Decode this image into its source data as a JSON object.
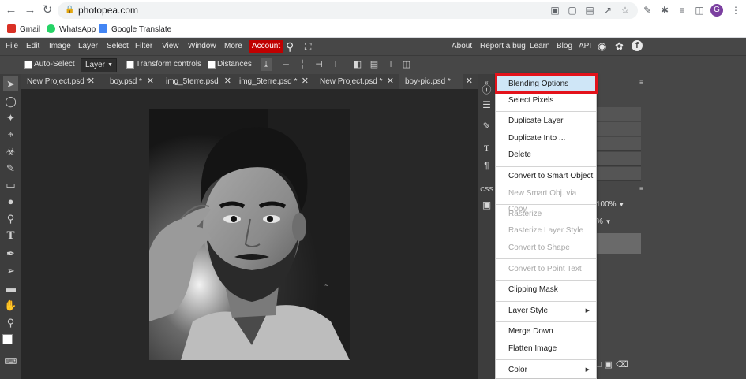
{
  "browser": {
    "url": "photopea.com",
    "profile_initial": "G",
    "bookmarks": [
      {
        "label": "Gmail",
        "color": "#d93025"
      },
      {
        "label": "WhatsApp",
        "color": "#25d366"
      },
      {
        "label": "Google Translate",
        "color": "#4285f4"
      }
    ]
  },
  "menu": {
    "left": [
      "File",
      "Edit",
      "Image",
      "Layer",
      "Select",
      "Filter",
      "View",
      "Window",
      "More"
    ],
    "account": "Account",
    "right": [
      "About",
      "Report a bug",
      "Learn",
      "Blog",
      "API"
    ]
  },
  "options": {
    "auto_select": "Auto-Select",
    "layer_select": "Layer",
    "transform_controls": "Transform controls",
    "distances": "Distances"
  },
  "doc_tabs": [
    "New Project.psd *",
    "boy.psd *",
    "img_5terre.psd",
    "img_5terre.psd *",
    "New Project.psd *",
    "boy-pic.psd *"
  ],
  "panel": {
    "opacity": "100%"
  },
  "context_menu": {
    "items": [
      {
        "label": "Blending Options",
        "disabled": false,
        "submenu": false
      },
      {
        "label": "Select Pixels",
        "disabled": false,
        "submenu": false
      },
      {
        "label": "Duplicate Layer",
        "disabled": false,
        "submenu": false
      },
      {
        "label": "Duplicate Into ...",
        "disabled": false,
        "submenu": false
      },
      {
        "label": "Delete",
        "disabled": false,
        "submenu": false
      },
      {
        "label": "Convert to Smart Object",
        "disabled": false,
        "submenu": false
      },
      {
        "label": "New Smart Obj. via Copy",
        "disabled": true,
        "submenu": false
      },
      {
        "label": "Rasterize",
        "disabled": true,
        "submenu": false
      },
      {
        "label": "Rasterize Layer Style",
        "disabled": true,
        "submenu": false
      },
      {
        "label": "Convert to Shape",
        "disabled": true,
        "submenu": false
      },
      {
        "label": "Convert to Point Text",
        "disabled": true,
        "submenu": false
      },
      {
        "label": "Clipping Mask",
        "disabled": false,
        "submenu": false
      },
      {
        "label": "Layer Style",
        "disabled": false,
        "submenu": true
      },
      {
        "label": "Merge Down",
        "disabled": false,
        "submenu": false
      },
      {
        "label": "Flatten Image",
        "disabled": false,
        "submenu": false
      },
      {
        "label": "Color",
        "disabled": false,
        "submenu": true
      }
    ]
  },
  "colors": {
    "highlight": "#e3121b",
    "account_bg": "#c00000",
    "selected_item_bg": "#cfe6f7"
  }
}
